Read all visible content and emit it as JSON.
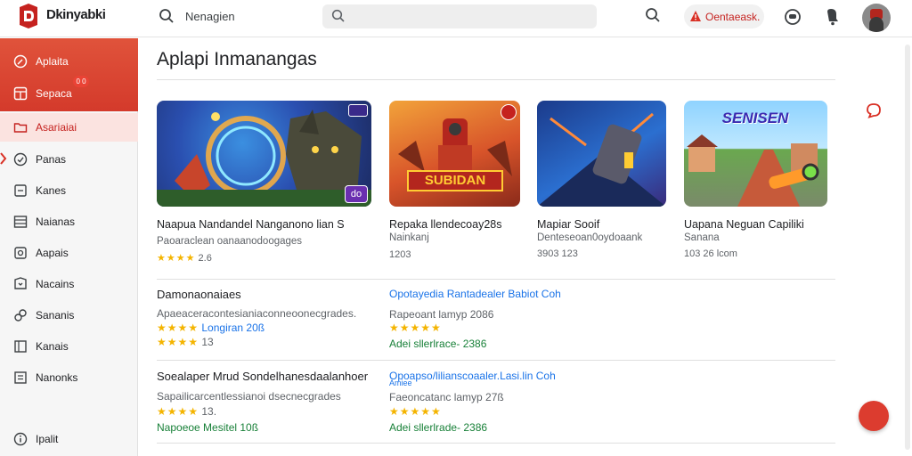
{
  "app": {
    "name": "Dkinyabki"
  },
  "header": {
    "search_label": "Nenagien",
    "search_placeholder": "",
    "chip_label": "Oentaeask.",
    "colors": {
      "accent": "#d93025"
    }
  },
  "sidebar": {
    "items": [
      {
        "label": "Aplaita",
        "icon": "compass-icon"
      },
      {
        "label": "Sepaca",
        "icon": "grid-icon",
        "badge": "0 0"
      },
      {
        "label": "Asariaiai",
        "icon": "folder-icon"
      },
      {
        "label": "Panas",
        "icon": "check-icon"
      },
      {
        "label": "Kanes",
        "icon": "box-icon"
      },
      {
        "label": "Naianas",
        "icon": "list-icon"
      },
      {
        "label": "Aapais",
        "icon": "settings-icon"
      },
      {
        "label": "Nacains",
        "icon": "tag-icon"
      },
      {
        "label": "Sananis",
        "icon": "link-icon"
      },
      {
        "label": "Kanais",
        "icon": "book-icon"
      },
      {
        "label": "Nanonks",
        "icon": "doc-icon"
      }
    ],
    "footer_label": "Ipalit"
  },
  "main": {
    "title": "Aplapi Inmanangas",
    "cards": [
      {
        "title": "Naapua Nandandel Nanganono lian S",
        "sub": "Paoaraclean oanaanodoogages",
        "stars": "★★★★",
        "meta": "2.6"
      },
      {
        "title": "Repaka llendecoay28s",
        "sub": "Nainkanj",
        "stars": "",
        "meta": "1203"
      },
      {
        "title": "Mapiar Sooif",
        "sub": "Denteseoan0oydoaank",
        "stars": "",
        "meta": "3903  123"
      },
      {
        "title": "Uapana Neguan Capiliki",
        "sub": "Sanana",
        "stars": "",
        "meta": "103 26  lcom"
      }
    ],
    "banner_text": "SUBIDAN",
    "banner_text2": "SENISEN",
    "badge_text": "do",
    "list": [
      {
        "title": "Damonaonaiaes",
        "sub": "Apaeaceracontesianiaconneoonecgrades.",
        "line3": "Longiran 20ß",
        "stars": "★★★★",
        "meta": "13",
        "right_title": "Opotayedia Rantadealer Babiot Coh",
        "right_sub": "Rapeoant   lamyp   2086",
        "right_stars": "★★★★★",
        "right_meta": "Adei sllerlrace-  2386"
      },
      {
        "title": "Soealaper Mrud Sondelhanesdaalanhoer",
        "sub": "Sapailicarcentlessianoi dsecnecgrades",
        "stars": "★★★★",
        "meta": "13.",
        "line4": "Napoeoe  Mesitel  10ß",
        "right_title": "Opoapso/lilianscoaaler.Lasi.lin Coh",
        "right_title2": "Amiee",
        "right_sub": "Faeoncatanc   lamyp   27ß",
        "right_stars": "★★★★★",
        "right_meta": "Adei sllerlrade-  2386"
      }
    ]
  }
}
